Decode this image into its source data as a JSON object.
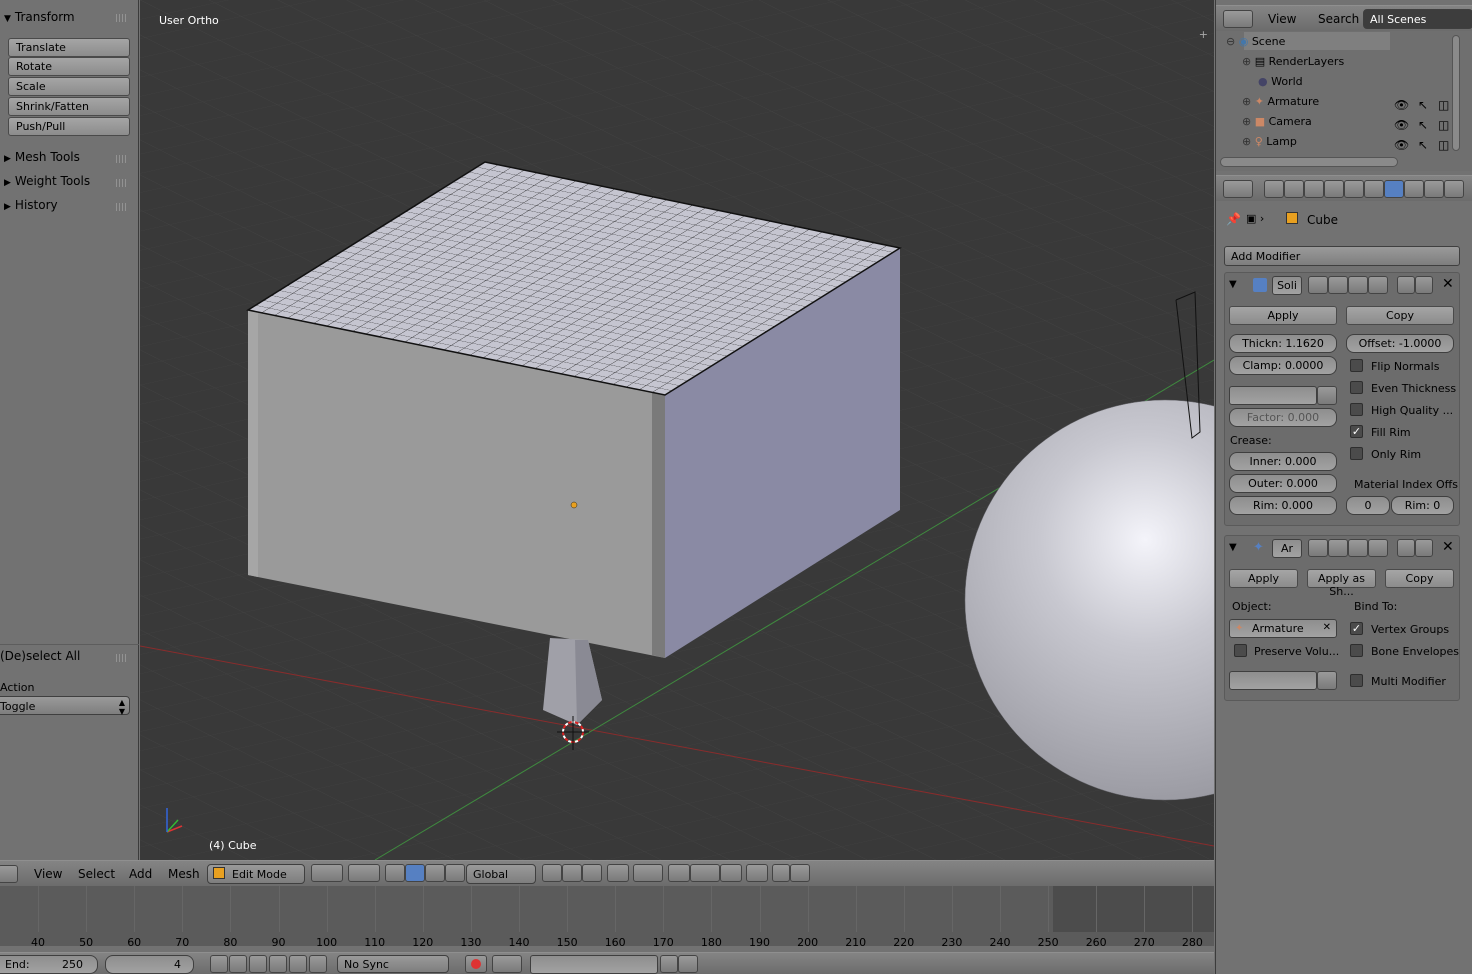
{
  "toolshelf": {
    "transform_title": "Transform",
    "transform_buttons": [
      "Translate",
      "Rotate",
      "Scale",
      "Shrink/Fatten",
      "Push/Pull"
    ],
    "panels": [
      "Mesh Tools",
      "Weight Tools",
      "History"
    ],
    "operator_title": "(De)select All",
    "action_label": "Action",
    "action_value": "Toggle"
  },
  "viewport": {
    "view_name": "User Ortho",
    "object_info": "(4) Cube"
  },
  "view_header": {
    "menus": [
      "View",
      "Select",
      "Add",
      "Mesh"
    ],
    "mode": "Edit Mode",
    "orientation": "Global"
  },
  "timeline": {
    "ticks": [
      "40",
      "50",
      "60",
      "70",
      "80",
      "90",
      "100",
      "110",
      "120",
      "130",
      "140",
      "150",
      "160",
      "170",
      "180",
      "190",
      "200",
      "210",
      "220",
      "230",
      "240",
      "250",
      "260",
      "270",
      "280"
    ],
    "end_label": "End:",
    "end_value": "250",
    "current_frame": "4",
    "sync": "No Sync"
  },
  "outliner": {
    "menus": [
      "View",
      "Search"
    ],
    "filter": "All Scenes",
    "items": [
      "Scene",
      "RenderLayers",
      "World",
      "Armature",
      "Camera",
      "Lamp"
    ]
  },
  "properties": {
    "object_name": "Cube",
    "add_modifier": "Add Modifier",
    "solidify": {
      "name": "Soli",
      "apply": "Apply",
      "copy": "Copy",
      "thickness": "Thickn: 1.1620",
      "offset": "Offset:  -1.0000",
      "clamp": "Clamp:  0.0000",
      "factor": "Factor:   0.000",
      "crease_label": "Crease:",
      "inner": "Inner:       0.000",
      "outer": "Outer:      0.000",
      "rim": "Rim:        0.000",
      "flip_normals": "Flip Normals",
      "even_thickness": "Even Thickness",
      "high_quality": "High Quality ...",
      "fill_rim": "Fill Rim",
      "only_rim": "Only Rim",
      "material_index": "Material Index Offs",
      "mat_offset": "0",
      "rim_offset": "Rim: 0"
    },
    "armature_mod": {
      "name": "Ar",
      "apply": "Apply",
      "apply_shape": "Apply as Sh...",
      "copy": "Copy",
      "object_label": "Object:",
      "object_value": "Armature",
      "bind_label": "Bind To:",
      "preserve_volume": "Preserve Volu...",
      "vertex_groups": "Vertex Groups",
      "bone_envelopes": "Bone Envelopes",
      "multi_modifier": "Multi Modifier"
    }
  }
}
